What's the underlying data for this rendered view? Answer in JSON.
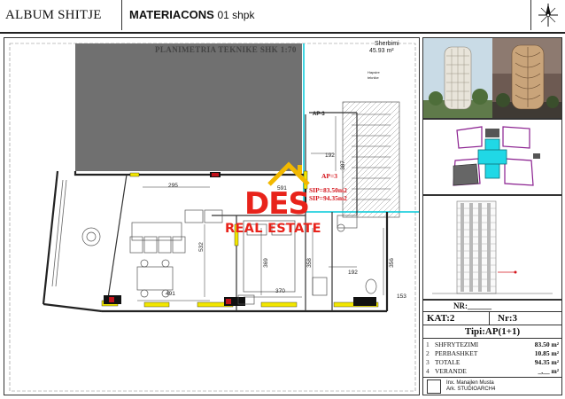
{
  "header": {
    "album": "ALBUM SHITJE",
    "company_bold": "MATERIACONS",
    "company_light": "01 shpk"
  },
  "plan": {
    "title": "PLANIMETRIA TEKNIKE SHK 1:70",
    "service_label": "Sherbimi",
    "service_area": "45.93 m²",
    "apartment_tag": "AP-3",
    "apartment_ref": "AP=3",
    "sip_net": "SIP=83.50m2",
    "sip_gross": "SIP=94.35m2",
    "small_note_1": "Hapsire",
    "small_note_2": "teknike",
    "dimensions": [
      "192",
      "387",
      "591",
      "295",
      "532",
      "369",
      "358",
      "192",
      "356",
      "491",
      "370",
      "153"
    ]
  },
  "logo": {
    "mark": "DES",
    "subtitle": "REAL ESTATE"
  },
  "info": {
    "nr_label": "NR:______",
    "kat": "KAT:2",
    "nr": "Nr:3",
    "tipi": "Tipi:AP(1+1)",
    "areas": [
      {
        "n": "1",
        "label": "SHFRYTEZIMI",
        "value": "83.50 m²"
      },
      {
        "n": "2",
        "label": "PERBASHKET",
        "value": "10.85 m²"
      },
      {
        "n": "3",
        "label": "TOTALE",
        "value": "94.35 m²"
      },
      {
        "n": "4",
        "label": "VERANDE",
        "value": "_,__ m²"
      }
    ],
    "author_1": "Inx. Manajlen Musta",
    "author_2": "Ark. STUDIOARCH4"
  },
  "colors": {
    "hatch": "#707070",
    "cyan_line": "#00c8d8",
    "yellow": "#f2e600",
    "red_text": "#d4141b",
    "keyplan_outline": "#8a1f8f",
    "keyplan_highlight": "#20d8e6"
  }
}
